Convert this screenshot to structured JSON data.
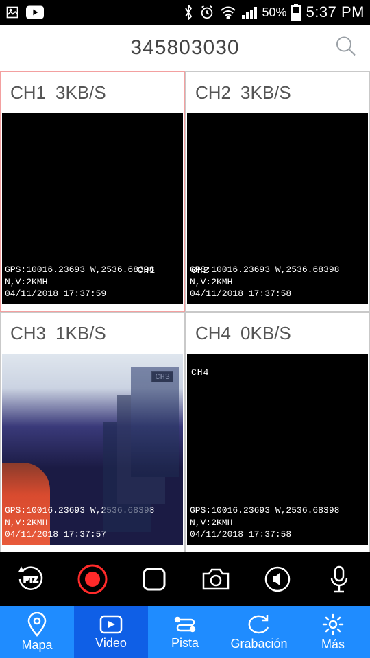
{
  "statusbar": {
    "battery_pct": "50%",
    "time": "5:37 PM"
  },
  "header": {
    "title": "345803030"
  },
  "channels": [
    {
      "name": "CH1",
      "rate": "3KB/S",
      "osd_ch": "CH1",
      "osd_line1": "GPS:10016.23693 W,2536.68398 N,V:2KMH",
      "osd_line2": "04/11/2018 17:37:59",
      "active": true
    },
    {
      "name": "CH2",
      "rate": "3KB/S",
      "osd_ch": "CH2",
      "osd_line1": "GPS:10016.23693 W,2536.68398 N,V:2KMH",
      "osd_line2": "04/11/2018 17:37:58",
      "active": false
    },
    {
      "name": "CH3",
      "rate": "1KB/S",
      "osd_ch": "CH3",
      "osd_line1": "GPS:10016.23693 W,2536.68398 N,V:2KMH",
      "osd_line2": "04/11/2018 17:37:57",
      "active": false
    },
    {
      "name": "CH4",
      "rate": "0KB/S",
      "osd_ch": "CH4",
      "osd_line1": "GPS:10016.23693 W,2536.68398 N,V:2KMH",
      "osd_line2": "04/11/2018 17:37:58",
      "active": false
    }
  ],
  "toolbar": {
    "ptz": "PTZ"
  },
  "nav": {
    "mapa": "Mapa",
    "video": "Video",
    "pista": "Pista",
    "grabacion": "Grabación",
    "mas": "Más"
  }
}
